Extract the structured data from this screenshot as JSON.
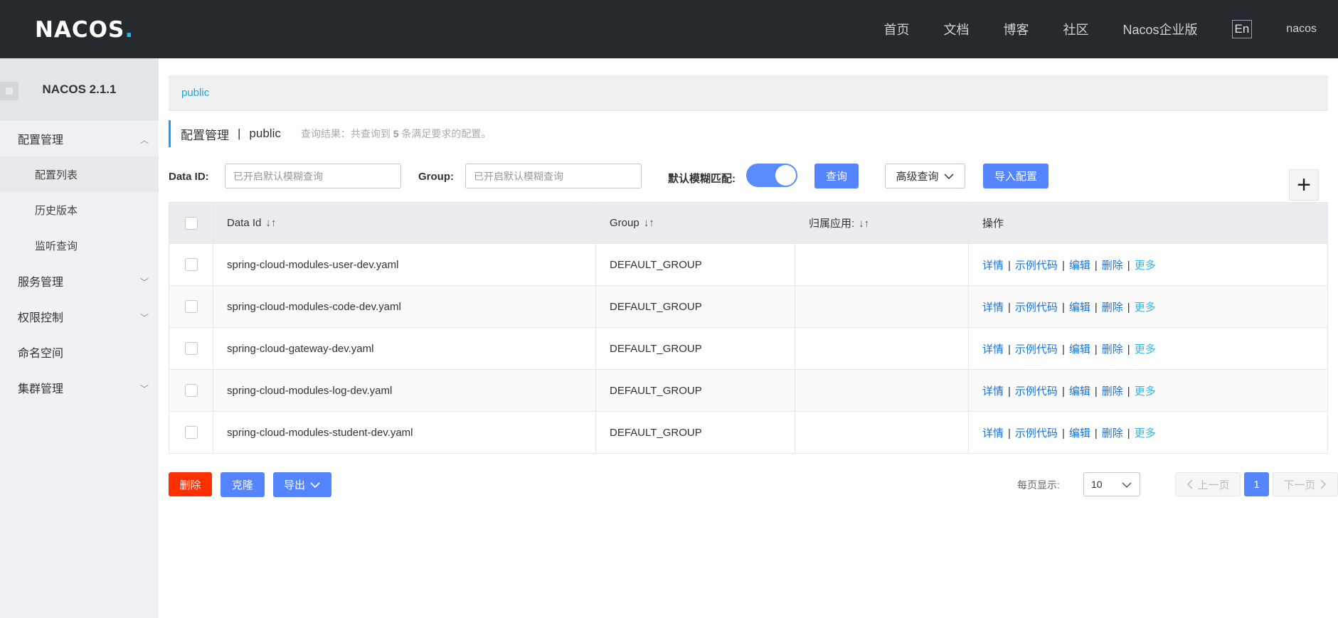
{
  "header": {
    "logo": "NACOS",
    "logo_dot": ".",
    "nav": [
      "首页",
      "文档",
      "博客",
      "社区",
      "Nacos企业版"
    ],
    "lang": "En",
    "user": "nacos"
  },
  "sidebar": {
    "title": "NACOS 2.1.1",
    "groups": [
      {
        "label": "配置管理",
        "expanded": true,
        "chevron": "︿",
        "items": [
          "配置列表",
          "历史版本",
          "监听查询"
        ]
      },
      {
        "label": "服务管理",
        "chevron": "﹀"
      },
      {
        "label": "权限控制",
        "chevron": "﹀"
      },
      {
        "label": "命名空间"
      },
      {
        "label": "集群管理",
        "chevron": "﹀"
      }
    ]
  },
  "breadcrumb": "public",
  "heading": {
    "title": "配置管理",
    "sep": "|",
    "namespace": "public",
    "result_prefix": "查询结果：共查询到",
    "result_count": "5",
    "result_suffix": "条满足要求的配置。"
  },
  "filters": {
    "dataid_label": "Data ID:",
    "dataid_placeholder": "已开启默认模糊查询",
    "group_label": "Group:",
    "group_placeholder": "已开启默认模糊查询",
    "fuzzy_label": "默认模糊匹配:",
    "fuzzy_on": true,
    "search_btn": "查询",
    "advanced_btn": "高级查询",
    "import_btn": "导入配置",
    "plus": "+"
  },
  "table": {
    "columns": [
      "Data Id",
      "Group",
      "归属应用:",
      "操作"
    ],
    "sort_icon": "↓↑",
    "rows": [
      {
        "data_id": "spring-cloud-modules-user-dev.yaml",
        "group": "DEFAULT_GROUP",
        "app": ""
      },
      {
        "data_id": "spring-cloud-modules-code-dev.yaml",
        "group": "DEFAULT_GROUP",
        "app": ""
      },
      {
        "data_id": "spring-cloud-gateway-dev.yaml",
        "group": "DEFAULT_GROUP",
        "app": ""
      },
      {
        "data_id": "spring-cloud-modules-log-dev.yaml",
        "group": "DEFAULT_GROUP",
        "app": ""
      },
      {
        "data_id": "spring-cloud-modules-student-dev.yaml",
        "group": "DEFAULT_GROUP",
        "app": ""
      }
    ],
    "ops": [
      "详情",
      "示例代码",
      "编辑",
      "删除",
      "更多"
    ]
  },
  "bottom": {
    "delete_btn": "删除",
    "clone_btn": "克隆",
    "export_btn": "导出",
    "pagesize_label": "每页显示:",
    "pagesize": "10",
    "prev": "上一页",
    "current_page": "1",
    "next": "下一页"
  },
  "colors": {
    "header_bg": "#252a2f",
    "primary": "#5584ff",
    "danger": "#ff3000",
    "link": "#1a74d7"
  }
}
